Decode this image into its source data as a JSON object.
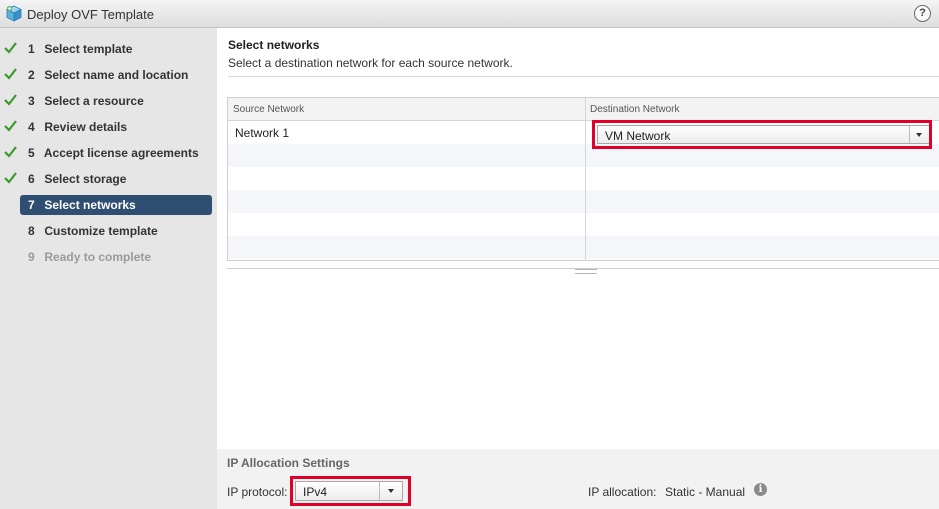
{
  "window": {
    "title": "Deploy OVF Template",
    "help_label": "?"
  },
  "steps": [
    {
      "num": "1",
      "label": "Select template",
      "state": "done"
    },
    {
      "num": "2",
      "label": "Select name and location",
      "state": "done"
    },
    {
      "num": "3",
      "label": "Select a resource",
      "state": "done"
    },
    {
      "num": "4",
      "label": "Review details",
      "state": "done"
    },
    {
      "num": "5",
      "label": "Accept license agreements",
      "state": "done"
    },
    {
      "num": "6",
      "label": "Select storage",
      "state": "done"
    },
    {
      "num": "7",
      "label": "Select networks",
      "state": "active"
    },
    {
      "num": "8",
      "label": "Customize template",
      "state": "pending"
    },
    {
      "num": "9",
      "label": "Ready to complete",
      "state": "disabled"
    }
  ],
  "page": {
    "title": "Select networks",
    "subtitle": "Select a destination network for each source network."
  },
  "grid": {
    "headers": {
      "source": "Source Network",
      "destination": "Destination Network"
    },
    "rows": [
      {
        "source": "Network 1",
        "destination": "VM Network"
      }
    ]
  },
  "ip_allocation": {
    "title": "IP Allocation Settings",
    "protocol_label": "IP protocol:",
    "protocol_value": "IPv4",
    "allocation_label": "IP allocation:",
    "allocation_value": "Static - Manual"
  },
  "colors": {
    "active_step": "#2e4e72",
    "check": "#3a9a2a",
    "highlight": "#e1002a"
  },
  "icons": [
    "ovf-template-icon",
    "help-icon",
    "checkmark-icon",
    "dropdown-arrow-icon",
    "info-icon"
  ]
}
